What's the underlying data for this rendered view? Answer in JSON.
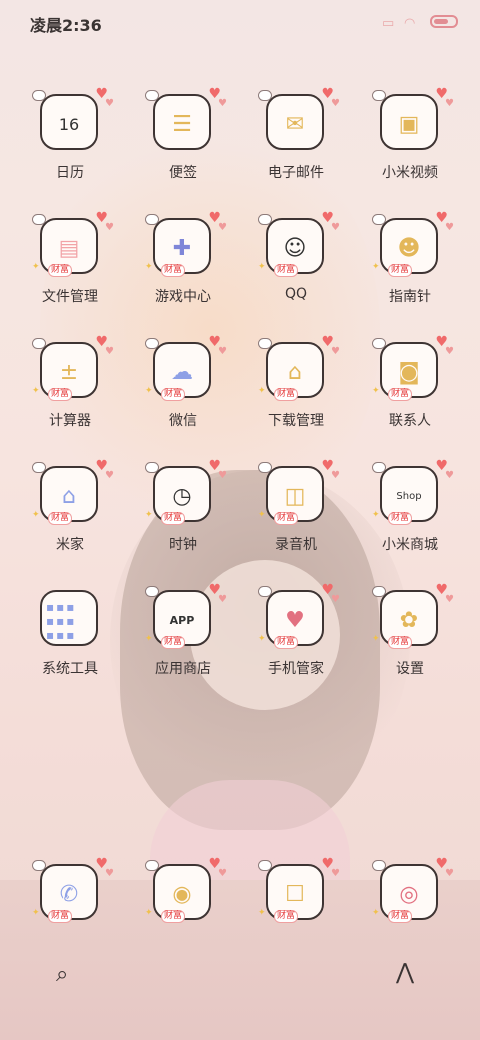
{
  "status_bar": {
    "time": "凌晨2:36",
    "battery_color": "#e28d93"
  },
  "apps": [
    {
      "label": "日历",
      "icon": "calendar-icon"
    },
    {
      "label": "便签",
      "icon": "notes-icon"
    },
    {
      "label": "电子邮件",
      "icon": "mail-icon"
    },
    {
      "label": "小米视频",
      "icon": "video-icon"
    },
    {
      "label": "文件管理",
      "icon": "folder-icon"
    },
    {
      "label": "游戏中心",
      "icon": "game-icon"
    },
    {
      "label": "QQ",
      "icon": "qq-icon"
    },
    {
      "label": "指南针",
      "icon": "compass-icon"
    },
    {
      "label": "计算器",
      "icon": "calculator-icon"
    },
    {
      "label": "微信",
      "icon": "wechat-icon"
    },
    {
      "label": "下载管理",
      "icon": "download-icon"
    },
    {
      "label": "联系人",
      "icon": "contacts-icon"
    },
    {
      "label": "米家",
      "icon": "home-icon"
    },
    {
      "label": "时钟",
      "icon": "clock-icon"
    },
    {
      "label": "录音机",
      "icon": "recorder-icon"
    },
    {
      "label": "小米商城",
      "icon": "shop-icon"
    },
    {
      "label": "系统工具",
      "icon": "tools-folder-icon"
    },
    {
      "label": "应用商店",
      "icon": "app-store-icon"
    },
    {
      "label": "手机管家",
      "icon": "security-icon"
    },
    {
      "label": "设置",
      "icon": "settings-icon"
    }
  ],
  "dock_apps": [
    {
      "icon": "phone-icon"
    },
    {
      "icon": "browser-icon"
    },
    {
      "icon": "messages-icon"
    },
    {
      "icon": "camera-icon"
    }
  ],
  "icon_badge_text": "财富",
  "calendar_day": "16",
  "app_store_text": "APP",
  "shop_text": "Shop",
  "dock": {
    "search_icon": "search-icon",
    "assistant_icon": "assistant-icon"
  }
}
